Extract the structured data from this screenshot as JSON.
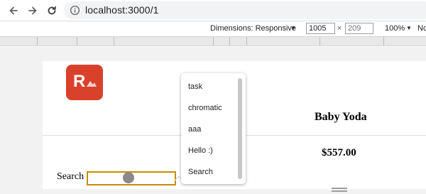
{
  "browser": {
    "url": "localhost:3000/1",
    "icons": [
      "back-arrow-icon",
      "forward-arrow-icon",
      "reload-icon",
      "site-info-icon"
    ]
  },
  "responsive_toolbar": {
    "dimensions_label": "Dimensions: Responsive",
    "width_value": "1005",
    "height_placeholder": "209",
    "times": "×",
    "zoom": "100%",
    "cut_label": "Nc"
  },
  "page": {
    "logo_letter": "R",
    "product_name": "Baby Yoda",
    "product_price": "$557.00",
    "search_label": "Search",
    "search_value": ""
  },
  "datalist": {
    "options": [
      "task",
      "chromatic",
      "aaa",
      "Hello :)",
      "Search"
    ]
  },
  "colors": {
    "logo_bg": "#d9412b",
    "input_focus": "#c98b00",
    "viewport_bg": "#f2f2f2"
  }
}
